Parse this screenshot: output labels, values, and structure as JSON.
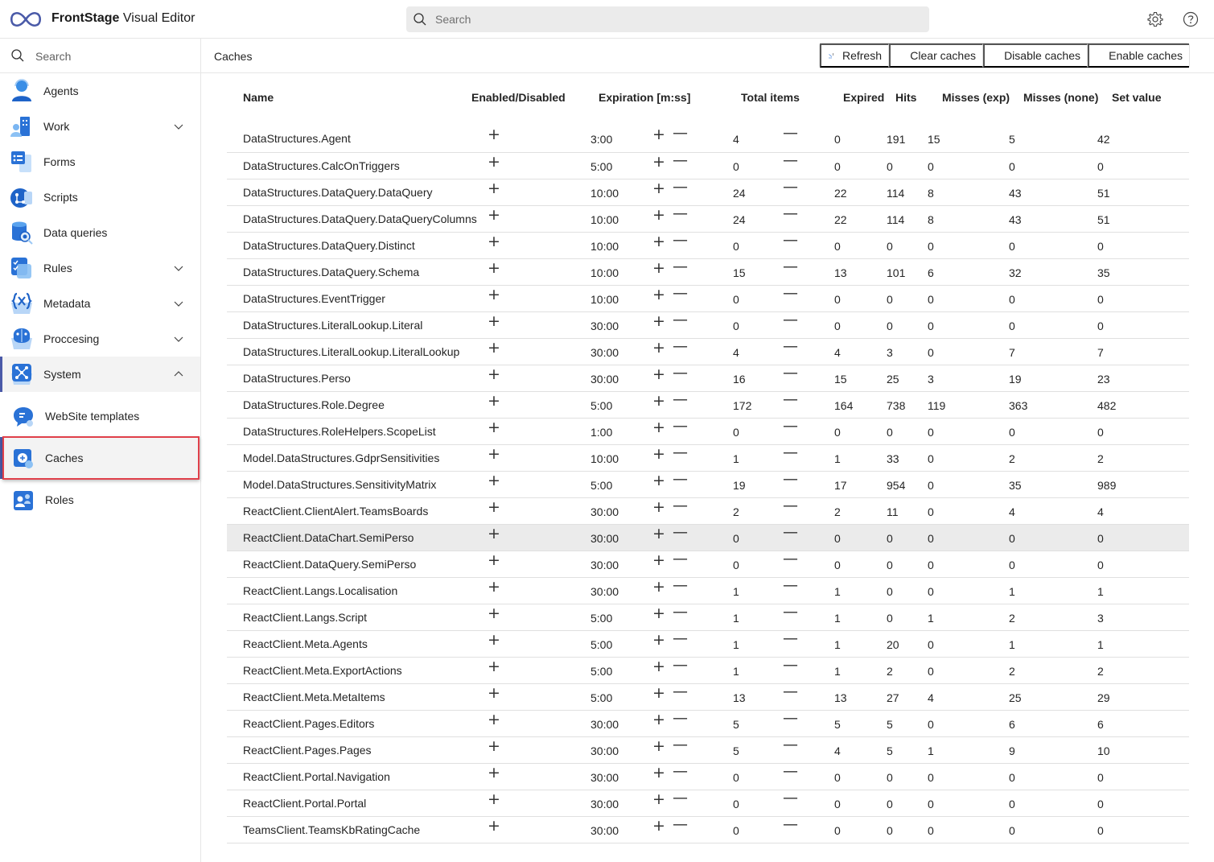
{
  "app": {
    "title_bold": "FrontStage",
    "title_rest": " Visual Editor",
    "search_placeholder": "Search",
    "icons": [
      "infinity-logo",
      "search-icon",
      "gear-icon",
      "help-icon"
    ]
  },
  "sidebar": {
    "search_placeholder": "Search",
    "items": [
      {
        "label": "Agents",
        "icon": "agent-icon",
        "expandable": false
      },
      {
        "label": "Work",
        "icon": "work-icon",
        "expandable": true
      },
      {
        "label": "Forms",
        "icon": "forms-icon",
        "expandable": false
      },
      {
        "label": "Scripts",
        "icon": "scripts-icon",
        "expandable": false
      },
      {
        "label": "Data queries",
        "icon": "data-queries-icon",
        "expandable": false
      },
      {
        "label": "Rules",
        "icon": "rules-icon",
        "expandable": true
      },
      {
        "label": "Metadata",
        "icon": "metadata-icon",
        "expandable": true
      },
      {
        "label": "Proccesing",
        "icon": "processing-icon",
        "expandable": true
      },
      {
        "label": "System",
        "icon": "system-icon",
        "expandable": true,
        "expanded": true
      }
    ],
    "subitems": [
      {
        "label": "WebSite templates",
        "icon": "website-templates-icon"
      },
      {
        "label": "Caches",
        "icon": "caches-icon",
        "active": true
      },
      {
        "label": "Roles",
        "icon": "roles-icon"
      }
    ]
  },
  "main": {
    "title": "Caches",
    "toolbar": {
      "refresh": "Refresh",
      "clear": "Clear caches",
      "disable": "Disable caches",
      "enable": "Enable caches"
    },
    "columns": [
      "Name",
      "Enabled/Disabled",
      "Expiration [m:ss]",
      "Total items",
      "Expired",
      "Hits",
      "Misses (exp)",
      "Misses (none)",
      "Set value"
    ],
    "controls": {
      "plus": "+",
      "minus": "—"
    },
    "rows": [
      {
        "name": "DataStructures.Agent",
        "expiration": "3:00",
        "total": "4",
        "expired": "0",
        "hits": "191",
        "misses_exp": "15",
        "misses_none": "5",
        "set_value": "42"
      },
      {
        "name": "DataStructures.CalcOnTriggers",
        "expiration": "5:00",
        "total": "0",
        "expired": "0",
        "hits": "0",
        "misses_exp": "0",
        "misses_none": "0",
        "set_value": "0"
      },
      {
        "name": "DataStructures.DataQuery.DataQuery",
        "expiration": "10:00",
        "total": "24",
        "expired": "22",
        "hits": "114",
        "misses_exp": "8",
        "misses_none": "43",
        "set_value": "51"
      },
      {
        "name": "DataStructures.DataQuery.DataQueryColumns",
        "expiration": "10:00",
        "total": "24",
        "expired": "22",
        "hits": "114",
        "misses_exp": "8",
        "misses_none": "43",
        "set_value": "51"
      },
      {
        "name": "DataStructures.DataQuery.Distinct",
        "expiration": "10:00",
        "total": "0",
        "expired": "0",
        "hits": "0",
        "misses_exp": "0",
        "misses_none": "0",
        "set_value": "0"
      },
      {
        "name": "DataStructures.DataQuery.Schema",
        "expiration": "10:00",
        "total": "15",
        "expired": "13",
        "hits": "101",
        "misses_exp": "6",
        "misses_none": "32",
        "set_value": "35"
      },
      {
        "name": "DataStructures.EventTrigger",
        "expiration": "10:00",
        "total": "0",
        "expired": "0",
        "hits": "0",
        "misses_exp": "0",
        "misses_none": "0",
        "set_value": "0"
      },
      {
        "name": "DataStructures.LiteralLookup.Literal",
        "expiration": "30:00",
        "total": "0",
        "expired": "0",
        "hits": "0",
        "misses_exp": "0",
        "misses_none": "0",
        "set_value": "0"
      },
      {
        "name": "DataStructures.LiteralLookup.LiteralLookup",
        "expiration": "30:00",
        "total": "4",
        "expired": "4",
        "hits": "3",
        "misses_exp": "0",
        "misses_none": "7",
        "set_value": "7"
      },
      {
        "name": "DataStructures.Perso",
        "expiration": "30:00",
        "total": "16",
        "expired": "15",
        "hits": "25",
        "misses_exp": "3",
        "misses_none": "19",
        "set_value": "23"
      },
      {
        "name": "DataStructures.Role.Degree",
        "expiration": "5:00",
        "total": "172",
        "expired": "164",
        "hits": "738",
        "misses_exp": "119",
        "misses_none": "363",
        "set_value": "482"
      },
      {
        "name": "DataStructures.RoleHelpers.ScopeList",
        "expiration": "1:00",
        "total": "0",
        "expired": "0",
        "hits": "0",
        "misses_exp": "0",
        "misses_none": "0",
        "set_value": "0"
      },
      {
        "name": "Model.DataStructures.GdprSensitivities",
        "expiration": "10:00",
        "total": "1",
        "expired": "1",
        "hits": "33",
        "misses_exp": "0",
        "misses_none": "2",
        "set_value": "2"
      },
      {
        "name": "Model.DataStructures.SensitivityMatrix",
        "expiration": "5:00",
        "total": "19",
        "expired": "17",
        "hits": "954",
        "misses_exp": "0",
        "misses_none": "35",
        "set_value": "989"
      },
      {
        "name": "ReactClient.ClientAlert.TeamsBoards",
        "expiration": "30:00",
        "total": "2",
        "expired": "2",
        "hits": "11",
        "misses_exp": "0",
        "misses_none": "4",
        "set_value": "4"
      },
      {
        "name": "ReactClient.DataChart.SemiPerso",
        "expiration": "30:00",
        "total": "0",
        "expired": "0",
        "hits": "0",
        "misses_exp": "0",
        "misses_none": "0",
        "set_value": "0",
        "hovered": true
      },
      {
        "name": "ReactClient.DataQuery.SemiPerso",
        "expiration": "30:00",
        "total": "0",
        "expired": "0",
        "hits": "0",
        "misses_exp": "0",
        "misses_none": "0",
        "set_value": "0"
      },
      {
        "name": "ReactClient.Langs.Localisation",
        "expiration": "30:00",
        "total": "1",
        "expired": "1",
        "hits": "0",
        "misses_exp": "0",
        "misses_none": "1",
        "set_value": "1"
      },
      {
        "name": "ReactClient.Langs.Script",
        "expiration": "5:00",
        "total": "1",
        "expired": "1",
        "hits": "0",
        "misses_exp": "1",
        "misses_none": "2",
        "set_value": "3"
      },
      {
        "name": "ReactClient.Meta.Agents",
        "expiration": "5:00",
        "total": "1",
        "expired": "1",
        "hits": "20",
        "misses_exp": "0",
        "misses_none": "1",
        "set_value": "1"
      },
      {
        "name": "ReactClient.Meta.ExportActions",
        "expiration": "5:00",
        "total": "1",
        "expired": "1",
        "hits": "2",
        "misses_exp": "0",
        "misses_none": "2",
        "set_value": "2"
      },
      {
        "name": "ReactClient.Meta.MetaItems",
        "expiration": "5:00",
        "total": "13",
        "expired": "13",
        "hits": "27",
        "misses_exp": "4",
        "misses_none": "25",
        "set_value": "29"
      },
      {
        "name": "ReactClient.Pages.Editors",
        "expiration": "30:00",
        "total": "5",
        "expired": "5",
        "hits": "5",
        "misses_exp": "0",
        "misses_none": "6",
        "set_value": "6"
      },
      {
        "name": "ReactClient.Pages.Pages",
        "expiration": "30:00",
        "total": "5",
        "expired": "4",
        "hits": "5",
        "misses_exp": "1",
        "misses_none": "9",
        "set_value": "10"
      },
      {
        "name": "ReactClient.Portal.Navigation",
        "expiration": "30:00",
        "total": "0",
        "expired": "0",
        "hits": "0",
        "misses_exp": "0",
        "misses_none": "0",
        "set_value": "0"
      },
      {
        "name": "ReactClient.Portal.Portal",
        "expiration": "30:00",
        "total": "0",
        "expired": "0",
        "hits": "0",
        "misses_exp": "0",
        "misses_none": "0",
        "set_value": "0"
      },
      {
        "name": "TeamsClient.TeamsKbRatingCache",
        "expiration": "30:00",
        "total": "0",
        "expired": "0",
        "hits": "0",
        "misses_exp": "0",
        "misses_none": "0",
        "set_value": "0"
      }
    ]
  },
  "colors": {
    "accent": "#4a5aa8",
    "highlight_border": "#e0404a",
    "row_hover": "#ebebeb",
    "search_bg": "#ebebeb",
    "icon_blue": "#2f7be0"
  }
}
